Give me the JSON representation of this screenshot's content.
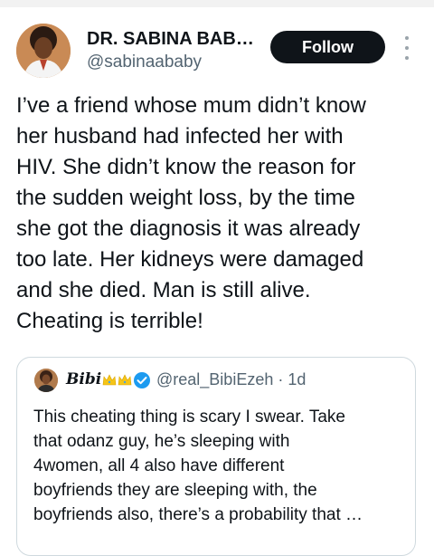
{
  "author": {
    "name": "DR. SABINA BAB…",
    "handle": "@sabinaababy"
  },
  "actions": {
    "follow_label": "Follow"
  },
  "tweet": {
    "lines": [
      "I’ve a friend whose mum didn’t know",
      "her husband had infected her with",
      "HIV. She didn’t know the reason for",
      "the sudden weight loss, by the time",
      "she got the diagnosis it was already",
      "too late. Her kidneys were damaged",
      "and she died. Man is still alive.",
      "Cheating is terrible!"
    ]
  },
  "quote": {
    "name": "Bibi",
    "handle": "@real_BibiEzeh",
    "time": "· 1d",
    "lines": [
      "This cheating thing is scary I swear. Take",
      "that odanz guy, he’s sleeping with",
      "4women, all 4 also have different",
      "boyfriends they are sleeping with, the",
      "boyfriends also, there’s a probability that …"
    ]
  },
  "colors": {
    "text": "#0f1419",
    "secondary": "#536471",
    "button": "#0f1419",
    "verified": "#1d9bf0",
    "crown": "#f5c518"
  },
  "icons": {
    "more": "more-vertical-icon",
    "verified": "verified-badge-icon",
    "crown": "crown-emoji-icon"
  }
}
